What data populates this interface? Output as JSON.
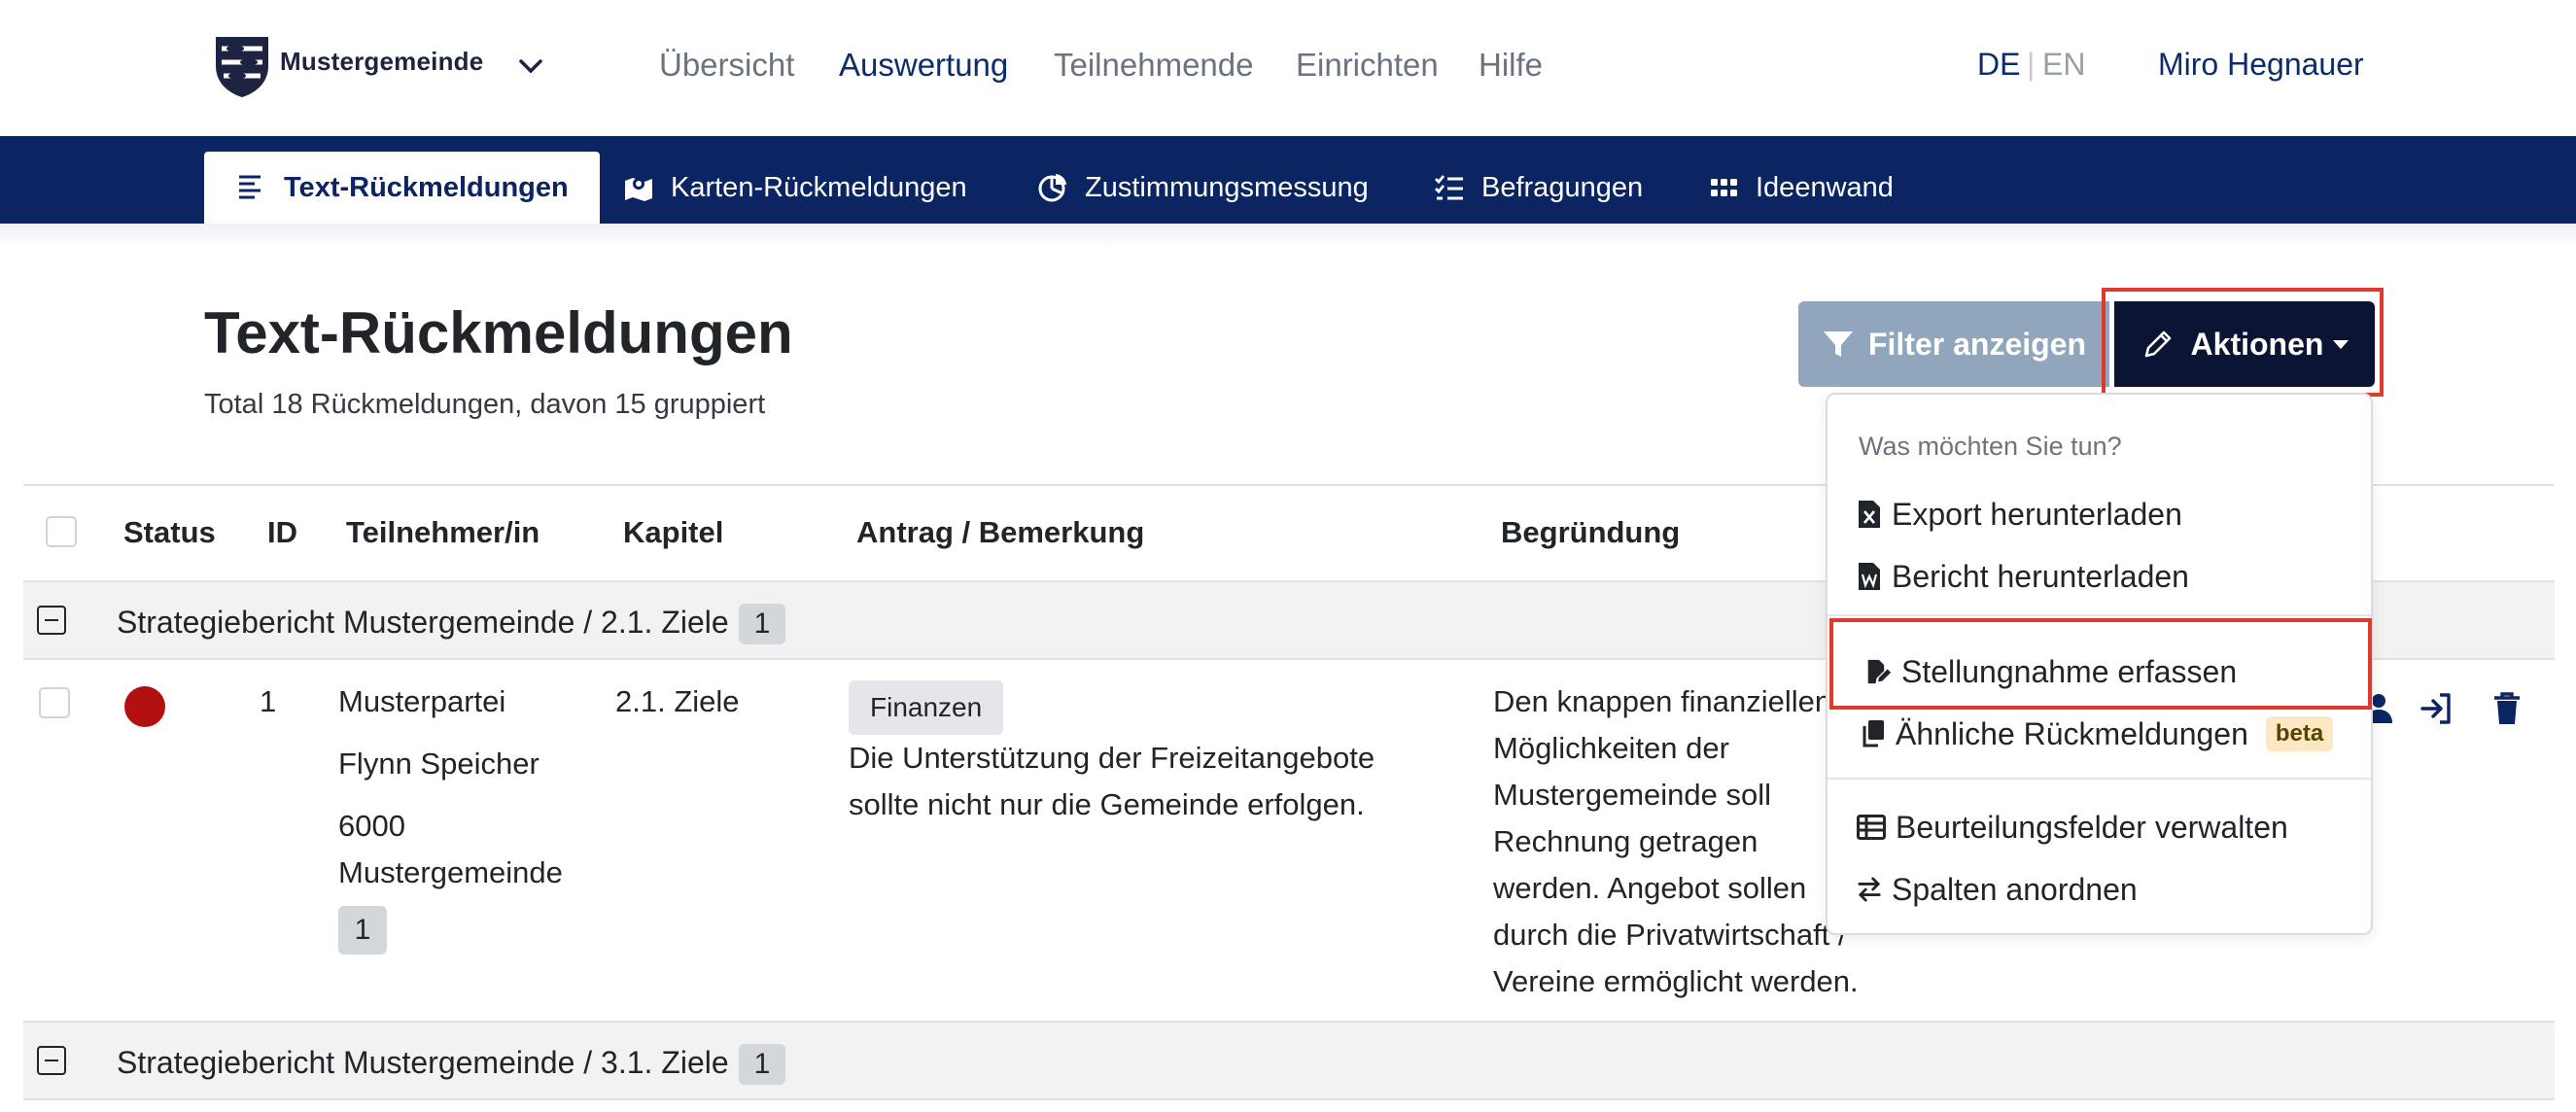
{
  "header": {
    "brand": "Mustergemeinde",
    "nav": [
      "Übersicht",
      "Auswertung",
      "Teilnehmende",
      "Einrichten",
      "Hilfe"
    ],
    "active_nav": "Auswertung",
    "lang_de": "DE",
    "lang_sep": "|",
    "lang_en": "EN",
    "user": "Miro Hegnauer"
  },
  "tabs": [
    {
      "label": "Text-Rückmeldungen",
      "icon": "text-lines-icon",
      "active": true
    },
    {
      "label": "Karten-Rückmeldungen",
      "icon": "map-pin-icon"
    },
    {
      "label": "Zustimmungsmessung",
      "icon": "pie-chart-icon"
    },
    {
      "label": "Befragungen",
      "icon": "checklist-icon"
    },
    {
      "label": "Ideenwand",
      "icon": "grid-dots-icon"
    }
  ],
  "page": {
    "title": "Text-Rückmeldungen",
    "subtitle": "Total 18 Rückmeldungen, davon 15 gruppiert",
    "filter_button": "Filter anzeigen",
    "actions_button": "Aktionen"
  },
  "dropdown": {
    "header": "Was möchten Sie tun?",
    "items": [
      {
        "label": "Export herunterladen",
        "icon": "excel-file-icon"
      },
      {
        "label": "Bericht herunterladen",
        "icon": "word-file-icon"
      },
      {
        "label": "Stellungnahme erfassen",
        "icon": "file-edit-icon"
      },
      {
        "label": "Ähnliche Rückmeldungen",
        "icon": "copy-icon",
        "badge": "beta"
      },
      {
        "label": "Beurteilungsfelder verwalten",
        "icon": "table-icon"
      },
      {
        "label": "Spalten anordnen",
        "icon": "swap-arrows-icon"
      }
    ]
  },
  "table": {
    "columns": [
      "Status",
      "ID",
      "Teilnehmer/in",
      "Kapitel",
      "Antrag / Bemerkung",
      "Begründung"
    ],
    "groups": [
      {
        "label": "Strategiebericht Mustergemeinde / 2.1. Ziele",
        "count": "1"
      },
      {
        "label": "Strategiebericht Mustergemeinde / 3.1. Ziele",
        "count": "1"
      }
    ],
    "rows": [
      {
        "status_color": "#b31010",
        "id": "1",
        "party": "Musterpartei",
        "name": "Flynn Speicher",
        "zip": "6000",
        "city": "Mustergemeinde",
        "participant_count": "1",
        "chapter": "2.1. Ziele",
        "tag": "Finanzen",
        "remark_line1": "Die Unterstützung der Freizeitangebote",
        "remark_line2": "sollte nicht nur die Gemeinde erfolgen.",
        "reason_lines": [
          "Den knappen finanziellen",
          "Möglichkeiten der",
          "Mustergemeinde soll",
          "Rechnung getragen",
          "werden. Angebot sollen",
          "durch die Privatwirtschaft /",
          "Vereine ermöglicht werden."
        ]
      }
    ]
  }
}
